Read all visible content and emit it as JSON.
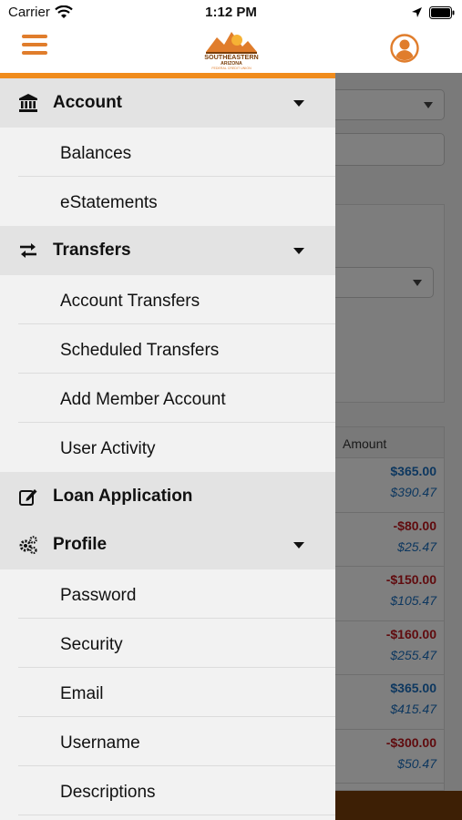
{
  "status_bar": {
    "carrier": "Carrier",
    "time": "1:12 PM"
  },
  "header": {
    "logo_text": [
      "SOUTHEASTERN",
      "ARIZONA",
      "FEDERAL CREDIT UNION"
    ]
  },
  "background": {
    "table_header": "Amount",
    "rows": [
      {
        "amount": "$365.00",
        "balance": "$390.47",
        "type": "pos"
      },
      {
        "amount": "-$80.00",
        "balance": "$25.47",
        "type": "neg"
      },
      {
        "amount": "-$150.00",
        "balance": "$105.47",
        "type": "neg"
      },
      {
        "amount": "-$160.00",
        "balance": "$255.47",
        "type": "neg"
      },
      {
        "amount": "$365.00",
        "balance": "$415.47",
        "type": "pos"
      },
      {
        "amount": "-$300.00",
        "balance": "$50.47",
        "type": "neg"
      }
    ]
  },
  "menu": {
    "account": {
      "label": "Account",
      "icon": "bank-icon",
      "items": [
        "Balances",
        "eStatements"
      ]
    },
    "transfers": {
      "label": "Transfers",
      "icon": "transfer-arrows-icon",
      "items": [
        "Account Transfers",
        "Scheduled Transfers",
        "Add Member Account",
        "User Activity"
      ]
    },
    "loan": {
      "label": "Loan Application",
      "icon": "edit-icon"
    },
    "profile": {
      "label": "Profile",
      "icon": "gears-icon",
      "items": [
        "Password",
        "Security",
        "Email",
        "Username",
        "Descriptions"
      ]
    }
  },
  "colors": {
    "accent": "#f08c1d",
    "brand_orange": "#e07d2c",
    "positive": "#1a6fbf",
    "negative": "#c0161c"
  }
}
